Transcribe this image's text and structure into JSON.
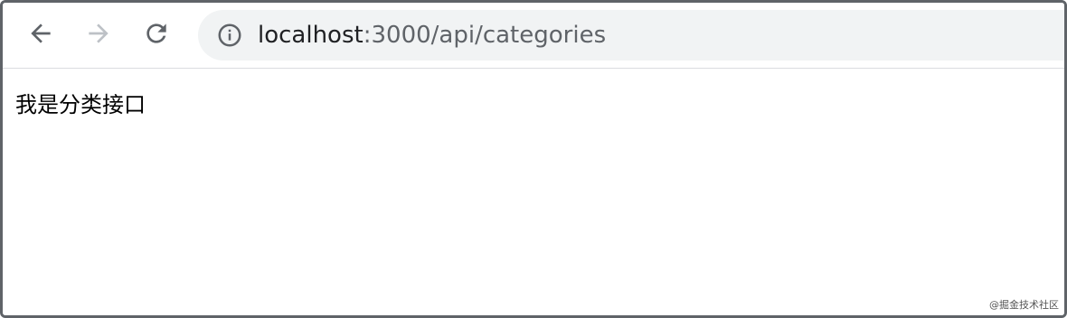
{
  "browser": {
    "address_bar": {
      "host": "localhost",
      "path": ":3000/api/categories"
    },
    "icons": {
      "back": "arrow-left-icon",
      "forward": "arrow-right-icon",
      "reload": "reload-icon",
      "info": "info-icon"
    },
    "colors": {
      "icon_active": "#5f6368",
      "icon_disabled": "#bdc1c6",
      "omnibox_bg": "#f1f3f4"
    }
  },
  "page": {
    "body_text": "我是分类接口"
  },
  "watermark": {
    "text": "@掘金技术社区"
  }
}
